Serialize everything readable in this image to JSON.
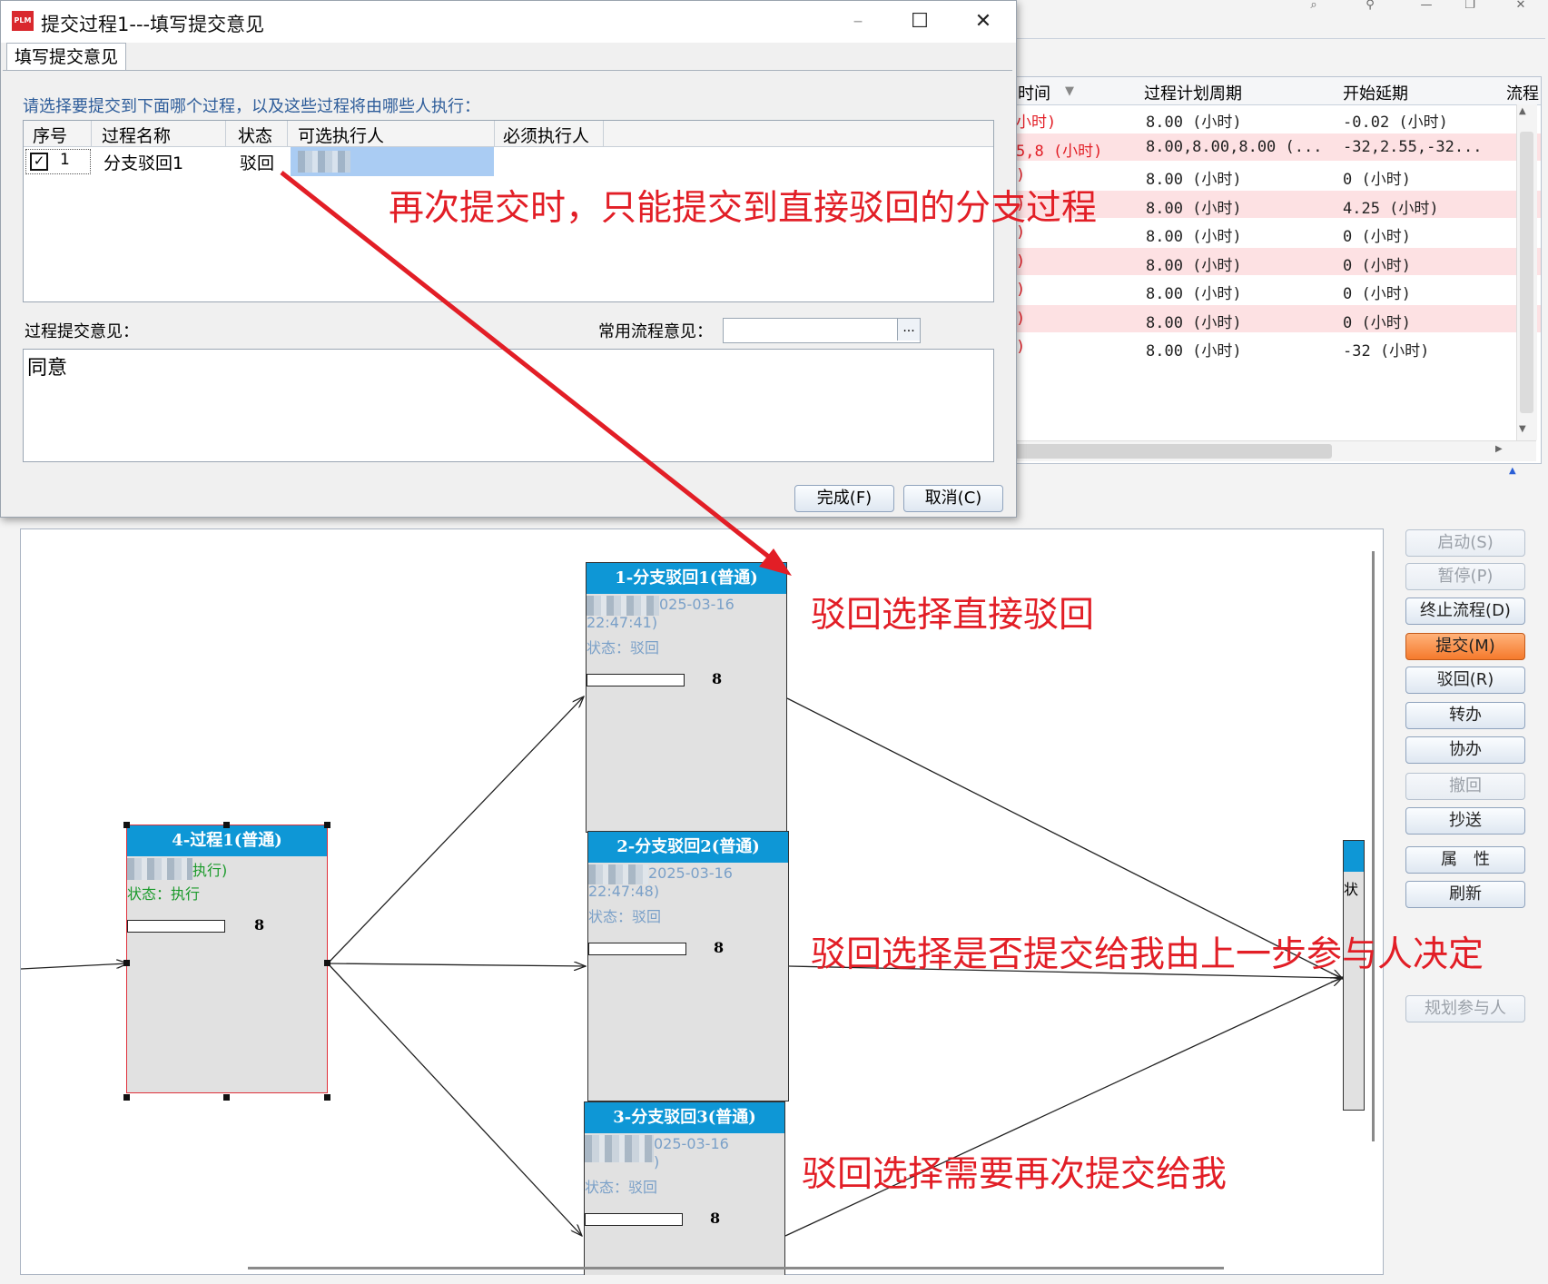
{
  "dialog": {
    "title": "提交过程1---填写提交意见",
    "logo_text": "PLM",
    "tab": "填写提交意见",
    "instruction": "请选择要提交到下面哪个过程，以及这些过程将由哪些人执行：",
    "columns": [
      "序号",
      "过程名称",
      "状态",
      "可选执行人",
      "必须执行人"
    ],
    "rows": [
      {
        "checked": true,
        "seq": "1",
        "name": "分支驳回1",
        "status": "驳回",
        "optional": "",
        "required": ""
      }
    ],
    "comment_label": "过程提交意见：",
    "common_label": "常用流程意见：",
    "common_value": "",
    "common_button": "...",
    "comment_value": "同意",
    "ok_button": "完成(F)",
    "cancel_button": "取消(C)"
  },
  "bg_table": {
    "columns": [
      "时间",
      "过程计划周期",
      "开始延期",
      "流程"
    ],
    "rows": [
      {
        "time": "小时)",
        "cycle": "8.00 (小时)",
        "delay": "-0.02 (小时)",
        "pink": false
      },
      {
        "time": "5,8 (小时)",
        "cycle": "8.00,8.00,8.00 (...",
        "delay": "-32,2.55,-32...",
        "pink": true
      },
      {
        "time": ")",
        "cycle": "8.00 (小时)",
        "delay": "0 (小时)",
        "pink": false
      },
      {
        "time": ")",
        "cycle": "8.00 (小时)",
        "delay": "4.25 (小时)",
        "pink": true
      },
      {
        "time": ")",
        "cycle": "8.00 (小时)",
        "delay": "0 (小时)",
        "pink": false
      },
      {
        "time": ")",
        "cycle": "8.00 (小时)",
        "delay": "0 (小时)",
        "pink": true
      },
      {
        "time": ")",
        "cycle": "8.00 (小时)",
        "delay": "0 (小时)",
        "pink": false
      },
      {
        "time": ")",
        "cycle": "8.00 (小时)",
        "delay": "0 (小时)",
        "pink": true
      },
      {
        "time": ")",
        "cycle": "8.00 (小时)",
        "delay": "-32 (小时)",
        "pink": false
      }
    ]
  },
  "actions": {
    "start": "启动(S)",
    "pause": "暂停(P)",
    "terminate": "终止流程(D)",
    "submit": "提交(M)",
    "reject": "驳回(R)",
    "transfer": "转办",
    "assist": "协办",
    "withdraw": "撤回",
    "cc": "抄送",
    "properties": "属　性",
    "refresh": "刷新",
    "plan_participants": "规划参与人"
  },
  "nodes": {
    "n4": {
      "title": "4-过程1(普通)",
      "line1": "执行)",
      "status": "状态：执行",
      "num": "8"
    },
    "n1": {
      "title": "1-分支驳回1(普通)",
      "date": "025-03-16",
      "time": "22:47:41)",
      "status": "状态：驳回",
      "num": "8"
    },
    "n2": {
      "title": "2-分支驳回2(普通)",
      "date": "2025-03-16",
      "time": "22:47:48)",
      "status": "状态：驳回",
      "num": "8"
    },
    "n3": {
      "title": "3-分支驳回3(普通)",
      "date": "025-03-16",
      "time": ")",
      "status": "状态：驳回",
      "num": "8"
    },
    "n5": {
      "status": "状"
    }
  },
  "annotations": {
    "a1": "再次提交时，只能提交到直接驳回的分支过程",
    "a2": "驳回选择直接驳回",
    "a3": "驳回选择是否提交给我由上一步参与人决定",
    "a4": "驳回选择需要再次提交给我"
  },
  "colors": {
    "accent": "#0e97d6",
    "annotation": "#e21e26",
    "submit": "#f57a2c"
  }
}
